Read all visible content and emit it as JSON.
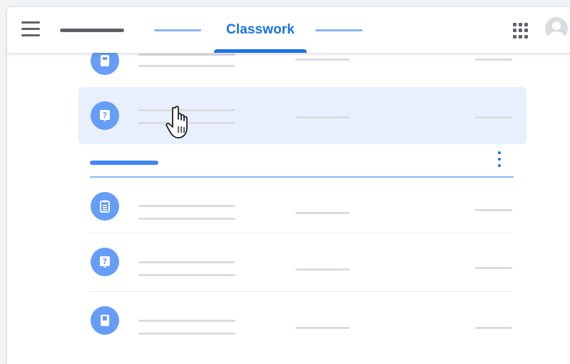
{
  "header": {
    "active_tab_label": "Classwork"
  },
  "icons": {
    "menu": "hamburger-menu-icon",
    "apps": "apps-grid-icon",
    "avatar": "account-avatar",
    "more": "more-vert-icon",
    "cursor": "hand-pointer-cursor"
  },
  "rows": [
    {
      "icon": "material-icon"
    },
    {
      "icon": "question-icon",
      "highlighted": true
    },
    {
      "icon": "assignment-icon"
    },
    {
      "icon": "question-icon"
    },
    {
      "icon": "material-icon"
    }
  ],
  "colors": {
    "accent": "#1a73e8",
    "icon_circle": "#669df6",
    "highlight": "#e8f0fe",
    "placeholder": "#dadce0"
  }
}
